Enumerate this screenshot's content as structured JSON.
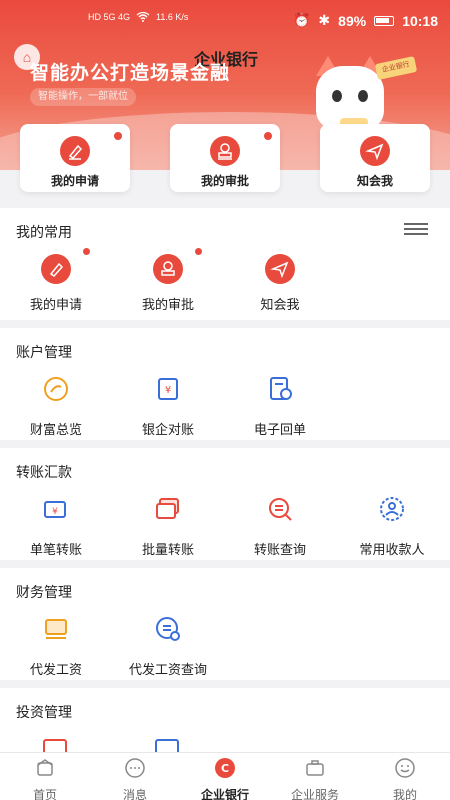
{
  "status_bar": {
    "carrier_tags": "HD 5G 4G",
    "speed": "11.6 K/s",
    "battery": "89%",
    "time": "10:18"
  },
  "header": {
    "app_title": "企业银行",
    "slogan": "智能办公打造场景金融",
    "sub_slogan": "智能操作，一部就位",
    "mascot_sign": "企业银行"
  },
  "quick_cards": [
    {
      "label": "我的申请",
      "icon": "edit-icon",
      "badge": true
    },
    {
      "label": "我的审批",
      "icon": "stamp-icon",
      "badge": true
    },
    {
      "label": "知会我",
      "icon": "send-icon",
      "badge": false
    }
  ],
  "sections": [
    {
      "title": "我的常用",
      "items": [
        {
          "label": "我的申请",
          "icon": "edit-icon",
          "badge": true
        },
        {
          "label": "我的审批",
          "icon": "stamp-icon",
          "badge": true
        },
        {
          "label": "知会我",
          "icon": "send-icon",
          "badge": false
        }
      ]
    },
    {
      "title": "账户管理",
      "items": [
        {
          "label": "财富总览",
          "icon": "wealth-icon"
        },
        {
          "label": "银企对账",
          "icon": "reconcile-icon"
        },
        {
          "label": "电子回单",
          "icon": "receipt-icon"
        }
      ]
    },
    {
      "title": "转账汇款",
      "items": [
        {
          "label": "单笔转账",
          "icon": "single-transfer-icon"
        },
        {
          "label": "批量转账",
          "icon": "batch-transfer-icon"
        },
        {
          "label": "转账查询",
          "icon": "transfer-query-icon"
        },
        {
          "label": "常用收款人",
          "icon": "payee-icon"
        }
      ]
    },
    {
      "title": "财务管理",
      "items": [
        {
          "label": "代发工资",
          "icon": "payroll-icon"
        },
        {
          "label": "代发工资查询",
          "icon": "payroll-query-icon"
        }
      ]
    },
    {
      "title": "投资管理",
      "items": []
    }
  ],
  "bottom_nav": [
    {
      "label": "首页",
      "icon": "home-icon",
      "active": false
    },
    {
      "label": "消息",
      "icon": "message-icon",
      "active": false
    },
    {
      "label": "企业银行",
      "icon": "corporate-bank-icon",
      "active": true
    },
    {
      "label": "企业服务",
      "icon": "briefcase-icon",
      "active": false
    },
    {
      "label": "我的",
      "icon": "profile-icon",
      "active": false
    }
  ],
  "colors": {
    "accent": "#e84b3d",
    "blue": "#3b6fd8",
    "orange": "#f0a020"
  }
}
